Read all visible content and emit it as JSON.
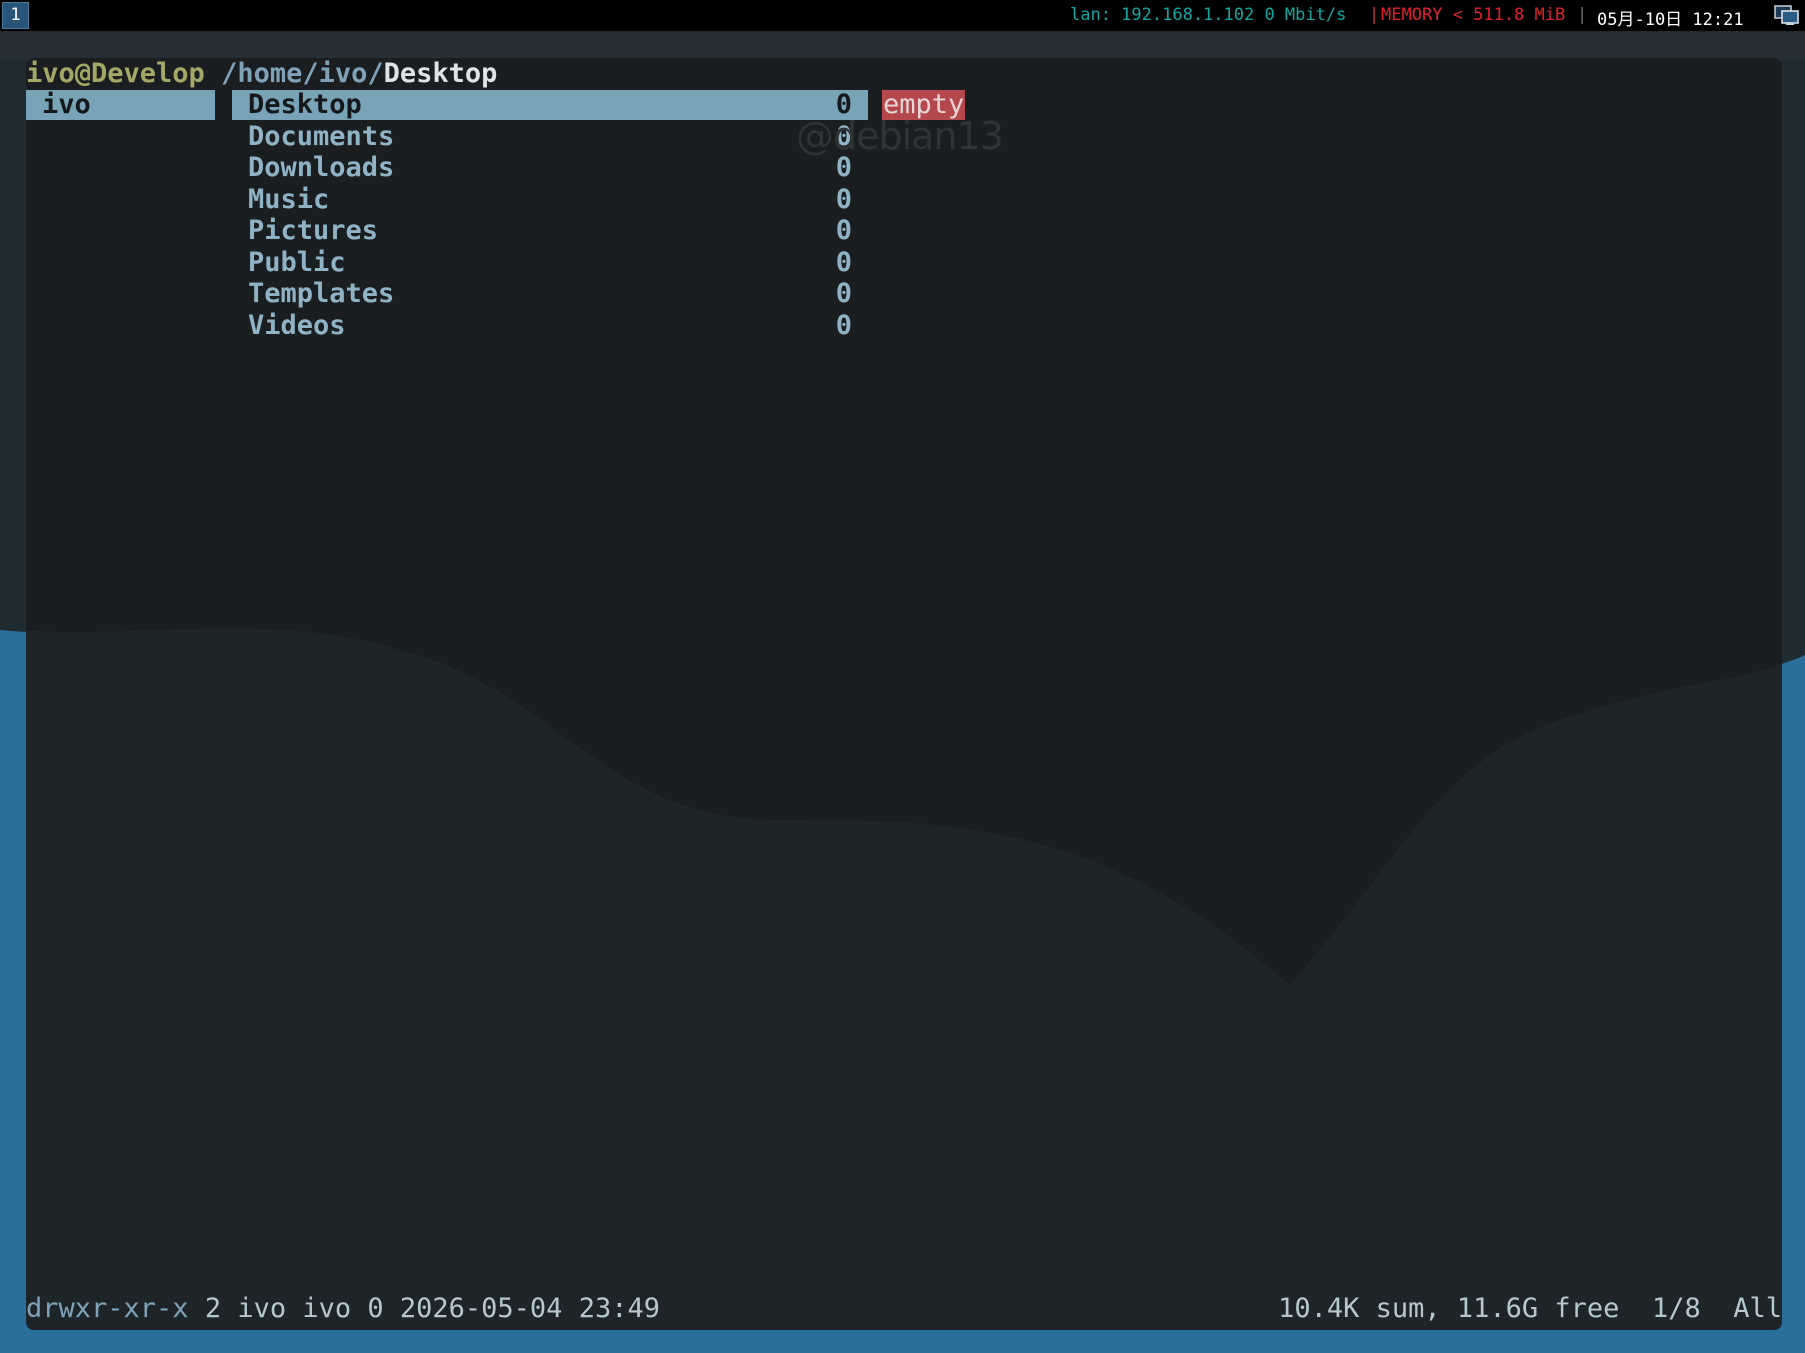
{
  "topbar": {
    "workspace": "1",
    "network": "lan: 192.168.1.102 0 Mbit/s",
    "separator": "|",
    "memory": "MEMORY < 511.8 MiB",
    "separator2": "|",
    "datetime": "05月-10日 12:21",
    "tray_icon": "network-computer-icon"
  },
  "terminal": {
    "title": {
      "user_host": "ivo@Develop",
      "path": "/home/ivo/",
      "current": "Desktop"
    },
    "parent_column": {
      "items": [
        {
          "label": "ivo",
          "selected": true
        }
      ]
    },
    "main_column": {
      "entries": [
        {
          "name": "Desktop",
          "count": "0",
          "selected": true
        },
        {
          "name": "Documents",
          "count": "0"
        },
        {
          "name": "Downloads",
          "count": "0"
        },
        {
          "name": "Music",
          "count": "0"
        },
        {
          "name": "Pictures",
          "count": "0"
        },
        {
          "name": "Public",
          "count": "0"
        },
        {
          "name": "Templates",
          "count": "0"
        },
        {
          "name": "Videos",
          "count": "0"
        }
      ]
    },
    "preview": {
      "label": "empty"
    },
    "status": {
      "permissions": "drwxr-xr-x",
      "meta": " 2 ivo ivo 0 2026-05-04 23:49",
      "disk": "10.4K sum, 11.6G free  1/8  All"
    }
  },
  "wallpaper": {
    "watermark": "@debian13"
  },
  "colors": {
    "selection": "#79a4b7",
    "empty_badge": "#b4484c",
    "wallpaper_blue": "#2a6e9c"
  }
}
